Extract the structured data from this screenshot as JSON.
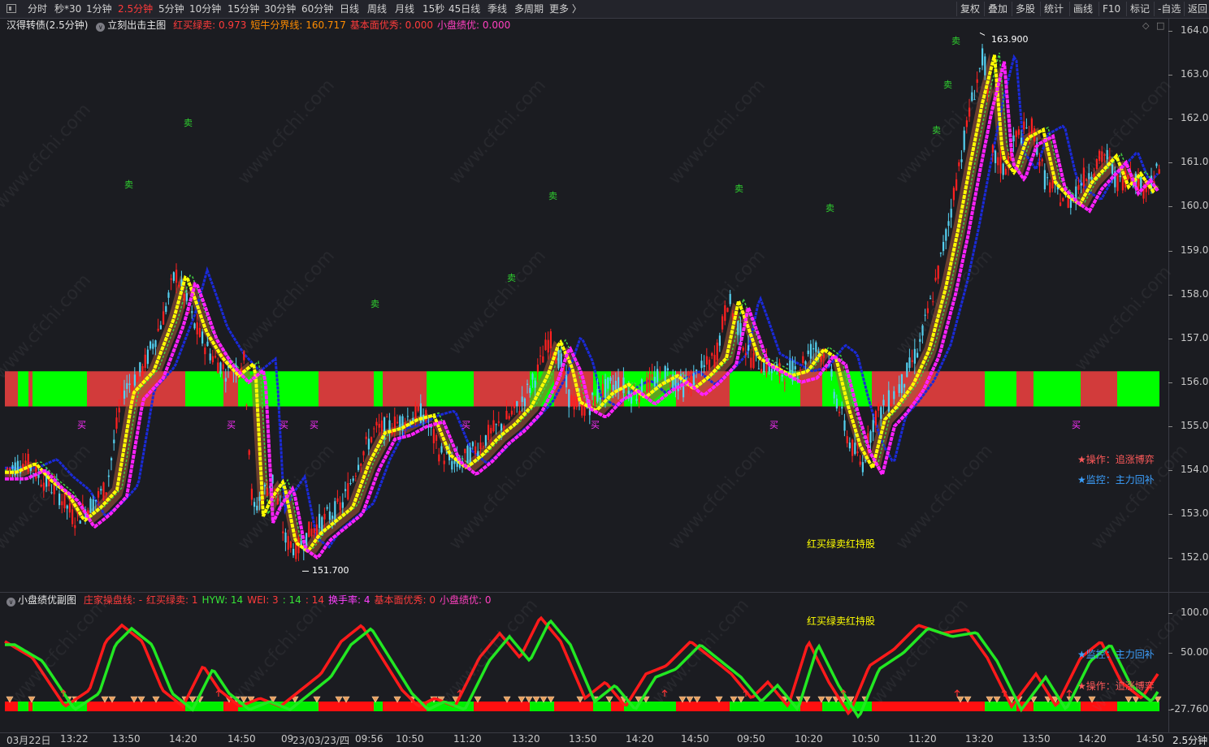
{
  "toolbar": {
    "periods": [
      "分时",
      "秒*30",
      "1分钟",
      "2.5分钟",
      "5分钟",
      "10分钟",
      "15分钟",
      "30分钟",
      "60分钟",
      "日线",
      "周线",
      "月线",
      "15秒",
      "45日线",
      "季线",
      "多周期",
      "更多 〉"
    ],
    "active_period": "2.5分钟",
    "right_buttons": [
      "复权",
      "叠加",
      "多股",
      "统计",
      "画线",
      "F10",
      "标记",
      "-自选",
      "返回"
    ]
  },
  "main": {
    "title": "汉得转债(2.5分钟)",
    "indicator_name": "立刻出击主图",
    "legend": [
      {
        "label": "红买绿卖:",
        "value": "0.973",
        "color": "#ff3b3b"
      },
      {
        "label": "短牛分界线:",
        "value": "160.717",
        "color": "#ff8c00"
      },
      {
        "label": "基本面优秀:",
        "value": "0.000",
        "color": "#ff3b3b"
      },
      {
        "label": "小盘绩优:",
        "value": "0.000",
        "color": "#ff40c0"
      }
    ],
    "high_label": "163.900",
    "low_label": "151.700",
    "right_axis": [
      "164.0",
      "163.0",
      "162.0",
      "161.0",
      "160.0",
      "159.0",
      "158.0",
      "157.0",
      "156.0",
      "155.0",
      "154.0",
      "153.0",
      "152.0"
    ],
    "sell_marker": "卖",
    "buy_marker": "买",
    "notes": {
      "operate": "★操作：追涨博弈",
      "monitor": "★监控：主力回补",
      "hold": "红买绿卖红持股"
    }
  },
  "sub": {
    "indicator_name": "小盘绩优副图",
    "legend": [
      {
        "label": "庄家操盘线:",
        "value": "-",
        "color": "#ff3b3b"
      },
      {
        "label": "红买绿卖:",
        "value": "1",
        "color": "#ff3b3b"
      },
      {
        "label": "HYW:",
        "value": "14",
        "color": "#37e437"
      },
      {
        "label": "WEI:",
        "value": "3",
        "color": "#ff3b3b"
      },
      {
        "label": ":",
        "value": "14",
        "color": "#37e437"
      },
      {
        "label": ":",
        "value": "14",
        "color": "#ff3b3b"
      },
      {
        "label": "换手率:",
        "value": "4",
        "color": "#ff40ff"
      },
      {
        "label": "基本面优秀:",
        "value": "0",
        "color": "#ff3b3b"
      },
      {
        "label": "小盘绩优:",
        "value": "0",
        "color": "#ff40c0"
      }
    ],
    "right_axis": [
      "100.0",
      "50.00",
      "-27.760"
    ],
    "notes": {
      "hold": "红买绿卖红持股",
      "monitor": "★监控：主力回补",
      "operate": "★操作：追涨博弈"
    }
  },
  "time_axis": {
    "labels": [
      "03月22日",
      "13:22",
      "13:50",
      "14:20",
      "14:50",
      "09",
      "23/03/23/四",
      "09:56",
      "10:50",
      "11:20",
      "13:20",
      "13:50",
      "14:20",
      "14:50",
      "09:50",
      "10:20",
      "10:50",
      "11:20",
      "13:20",
      "13:50",
      "14:20",
      "14:50"
    ],
    "period": "2.5分钟"
  },
  "watermark": "www.cfchi.com",
  "colors": {
    "bg": "#1b1c21",
    "up": "#ff2020",
    "down": "#54d0f0",
    "yellow": "#ffff00",
    "magenta": "#ff20ff",
    "band_red": "#d23b3b",
    "band_green": "#00ff00",
    "blue_line": "#1a2ad8"
  }
}
